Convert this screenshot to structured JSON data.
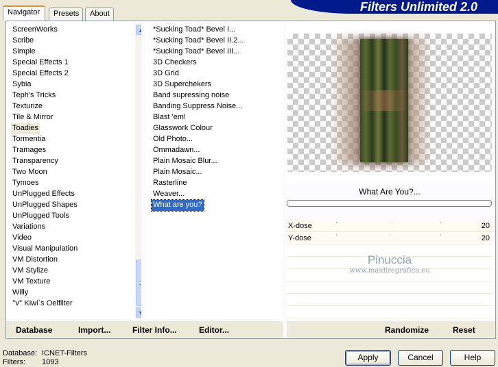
{
  "tabs": [
    {
      "label": "Navigator",
      "active": true
    },
    {
      "label": "Presets",
      "active": false
    },
    {
      "label": "About",
      "active": false
    }
  ],
  "banner_title": "Filters Unlimited 2.0",
  "categories": {
    "items": [
      "ScreenWorks",
      "Scribe",
      "Simple",
      "Special Effects 1",
      "Special Effects 2",
      "Sybia",
      "Teph's Tricks",
      "Texturize",
      "Tile & Mirror",
      "Toadies",
      "Tormentia",
      "Tramages",
      "Transparency",
      "Two Moon",
      "Tymoes",
      "UnPlugged Effects",
      "UnPlugged Shapes",
      "UnPlugged Tools",
      "Variations",
      "Video",
      "Visual Manipulation",
      "VM Distortion",
      "VM Stylize",
      "VM Texture",
      "Willy",
      "°v° Kiwi`s Oelfilter"
    ],
    "highlighted": "Toadies",
    "scroll_up_icon": "arrow-up-icon",
    "scroll_down_icon": "arrow-down-icon"
  },
  "filters": {
    "items": [
      "*Sucking Toad*  Bevel I...",
      "*Sucking Toad*  Bevel II.2...",
      "*Sucking Toad*  Bevel III...",
      "3D Checkers",
      "3D Grid",
      "3D Superchekers",
      "Band supressing noise",
      "Banding Suppress Noise...",
      "Blast 'em!",
      "Glasswork Colour",
      "Old Photo...",
      "Ommadawn...",
      "Plain Mosaic Blur...",
      "Plain Mosaic...",
      "Rasterline",
      "Weaver...",
      "What are you?"
    ],
    "selected": "What are you?"
  },
  "preview": {
    "filter_name": "What Are You?...",
    "progress": 0
  },
  "params": [
    {
      "label": "X-dose",
      "value": "20"
    },
    {
      "label": "Y-dose",
      "value": "20"
    }
  ],
  "watermark": {
    "name": "Pinuccia",
    "url": "www.maidiregrafica.eu"
  },
  "bottom_links": {
    "database": "Database",
    "import": "Import...",
    "filter_info": "Filter Info...",
    "editor": "Editor...",
    "randomize": "Randomize",
    "reset": "Reset"
  },
  "status": {
    "database_label": "Database:",
    "database_value": "ICNET-Filters",
    "filters_label": "Filters:",
    "filters_value": "1093"
  },
  "buttons": {
    "apply": "Apply",
    "cancel": "Cancel",
    "help": "Help"
  }
}
